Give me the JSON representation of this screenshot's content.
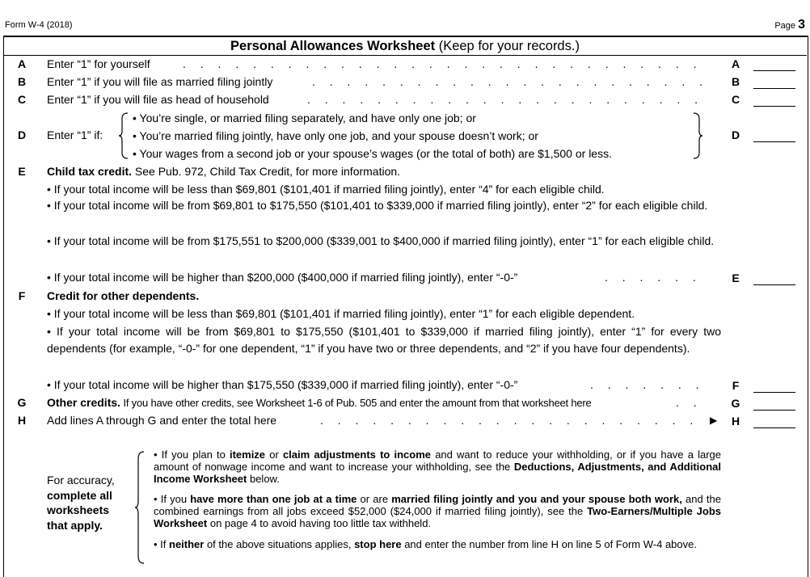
{
  "header": {
    "form_id": "Form W-4 (2018)",
    "page_label": "Page",
    "page_number": "3"
  },
  "title": {
    "bold": "Personal Allowances Worksheet",
    "rest": " (Keep for your records.)"
  },
  "lines": {
    "A": {
      "letter": "A",
      "text": "Enter “1” for yourself"
    },
    "B": {
      "letter": "B",
      "text": "Enter “1” if you will file as married filing jointly"
    },
    "C": {
      "letter": "C",
      "text": "Enter “1” if you will file as head of household"
    },
    "D": {
      "letter": "D",
      "text": "Enter “1” if:",
      "options": [
        "• You’re single, or married filing separately, and have only one job; or",
        "• You’re married filing jointly, have only one job, and your spouse doesn’t work; or",
        "• Your wages from a second job or your spouse’s wages (or the total of both) are $1,500 or less."
      ]
    },
    "E": {
      "letter": "E",
      "heading": "Child tax credit.",
      "intro": " See Pub. 972, Child Tax Credit, for more information.",
      "b1": "• If your total income will be less than $69,801 ($101,401 if married filing jointly), enter “4” for each eligible child.",
      "b2": "• If your total income will be from $69,801 to $175,550 ($101,401 to $339,000 if married filing jointly), enter “2” for each eligible child.",
      "b3": "• If your total income will be from $175,551 to $200,000 ($339,001 to $400,000 if married filing jointly), enter “1” for each eligible child.",
      "b4": "• If your total income will be higher than $200,000 ($400,000 if married filing jointly), enter “-0-”"
    },
    "F": {
      "letter": "F",
      "heading": "Credit for other dependents.",
      "b1": "• If your total income will be less than $69,801 ($101,401 if married filing jointly), enter “1” for each eligible dependent.",
      "b2": "• If your total income will be from $69,801 to $175,550 ($101,401 to $339,000 if married filing jointly), enter “1” for every two dependents (for example, “-0-” for one dependent, “1” if you have two or three dependents, and “2” if you have four dependents).",
      "b3": "• If your total income will be higher than $175,550 ($339,000 if married filing jointly), enter “-0-”"
    },
    "G": {
      "letter": "G",
      "heading": "Other credits.",
      "text": " If you have other credits, see Worksheet 1-6 of Pub. 505 and enter the amount from that worksheet here"
    },
    "H": {
      "letter": "H",
      "text": "Add lines A through G and enter the total here",
      "arrow": "▶"
    }
  },
  "accuracy": {
    "label_1": "For accuracy,",
    "label_2": "complete all",
    "label_3": "worksheets",
    "label_4": "that apply.",
    "p1": {
      "a": "• If you plan to ",
      "b": "itemize",
      "c": " or ",
      "d": "claim adjustments to income",
      "e": " and want to reduce your withholding, or if you have a large amount of nonwage income and want to increase your withholding, see the ",
      "f": "Deductions, Adjustments, and Additional Income Worksheet",
      "g": " below."
    },
    "p2": {
      "a": "• If you ",
      "b": "have more than one job at a time",
      "c": " or are ",
      "d": "married filing jointly and you and your spouse both work,",
      "e": " and the combined earnings from all jobs exceed $52,000 ($24,000 if married filing jointly), see the ",
      "f": "Two-Earners/Multiple Jobs Worksheet",
      "g": " on page 4 to avoid having too little tax withheld."
    },
    "p3": {
      "a": "• If ",
      "b": "neither",
      "c": " of the above situations applies, ",
      "d": "stop here",
      "e": " and enter the number from line H on line 5 of Form W-4 above."
    }
  }
}
